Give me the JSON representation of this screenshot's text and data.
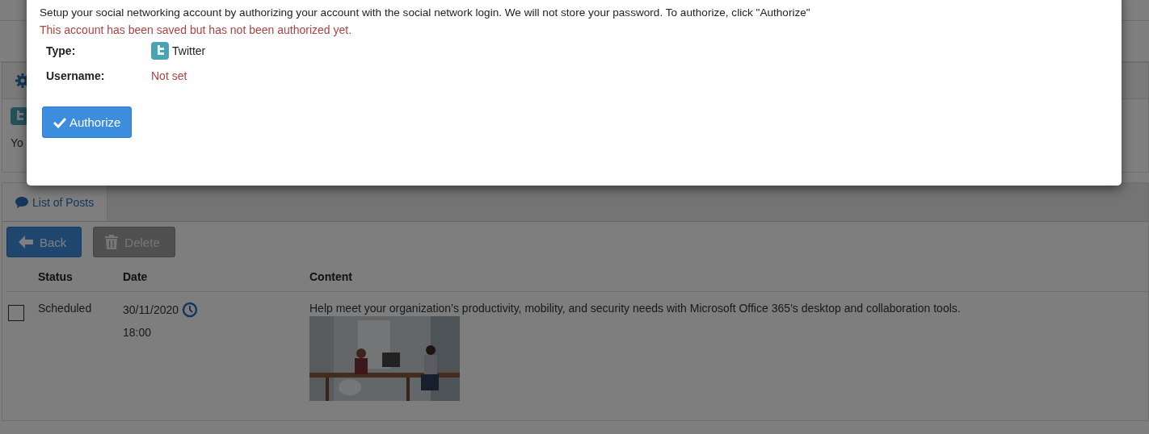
{
  "background": {
    "account_fragment": "Yo"
  },
  "modal": {
    "description": "Setup your social networking account by authorizing your account with the social network login. We will not store your password. To authorize, click \"Authorize\"",
    "warning": "This account has been saved but has not been authorized yet.",
    "fields": [
      {
        "label": "Type:",
        "value": "Twitter",
        "kind": "network"
      },
      {
        "label": "Username:",
        "value": "Not set",
        "kind": "missing"
      }
    ],
    "button": "Authorize"
  },
  "tabs": [
    {
      "label": "List of Posts",
      "selected": true
    }
  ],
  "toolbar": [
    {
      "label": "Back",
      "kind": "back"
    },
    {
      "label": "Delete",
      "kind": "delete"
    }
  ],
  "table": {
    "columns": [
      "Status",
      "Date",
      "Content"
    ],
    "rows": [
      {
        "checked": false,
        "status": "Scheduled",
        "date": "30/11/2020",
        "time": "18:00",
        "content": "Help meet your organization’s productivity, mobility, and security needs with Microsoft Office 365’s desktop and collaboration tools."
      }
    ]
  }
}
